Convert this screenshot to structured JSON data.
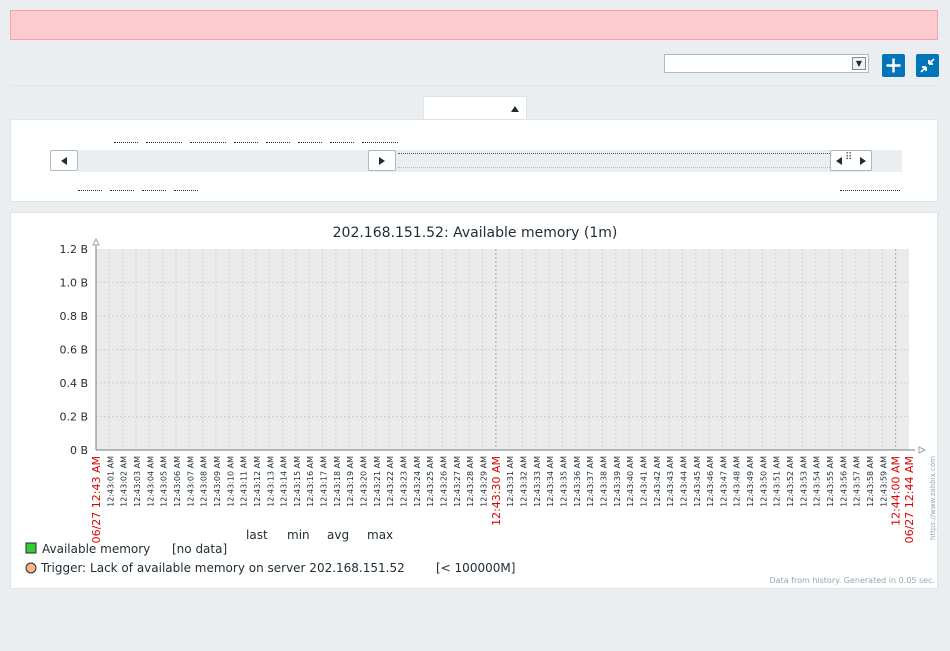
{
  "graph": {
    "title": "202.168.151.52: Available memory (1m)",
    "y_ticks": [
      "1.2 B",
      "1.0 B",
      "0.8 B",
      "0.6 B",
      "0.4 B",
      "0.2 B",
      "0 B"
    ],
    "x_start_label": "06/27 12:43 AM",
    "x_end_label": "06/27 12:44 AM",
    "x_mid_label": "12:43:30 AM",
    "x_mid2_label": "12:44:00 AM",
    "watermark": "https://www.zabbix.com",
    "legend_headers": [
      "last",
      "min",
      "avg",
      "max"
    ],
    "legend_item_name": "Available memory",
    "legend_item_value": "[no data]",
    "legend_item_color": "#33cc33",
    "trigger_label": "Trigger: Lack of available memory on server 202.168.151.52",
    "trigger_value": "[< 100000M]",
    "trigger_color": "#ffb380",
    "footer": "Data from history. Generated in 0.05 sec."
  },
  "chart_data": {
    "type": "line",
    "title": "202.168.151.52: Available memory (1m)",
    "ylim": [
      0,
      1.2
    ],
    "y_unit": "B",
    "x_range": [
      "06/27 12:43 AM",
      "06/27 12:44 AM"
    ],
    "series": [
      {
        "name": "Available memory",
        "values": []
      }
    ],
    "grid": true,
    "legend": "bottom-left"
  }
}
